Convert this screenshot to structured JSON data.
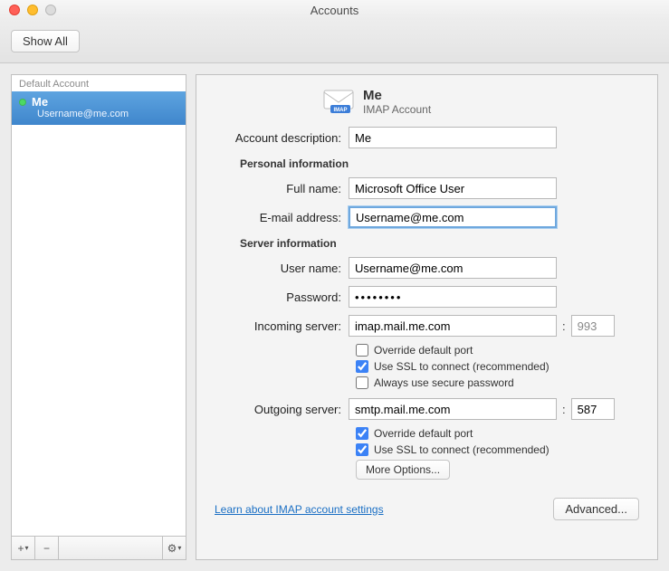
{
  "window": {
    "title": "Accounts"
  },
  "toolbar": {
    "show_all": "Show All"
  },
  "sidebar": {
    "header": "Default Account",
    "account": {
      "name": "Me",
      "email": "Username@me.com"
    },
    "footer": {
      "add": "+",
      "remove": "−",
      "add_caret": "▾",
      "gear": "⚙",
      "gear_caret": "▾"
    }
  },
  "main": {
    "header": {
      "name": "Me",
      "type": "IMAP Account",
      "badge": "IMAP"
    },
    "labels": {
      "account_description": "Account description:",
      "personal_info": "Personal information",
      "full_name": "Full name:",
      "email": "E-mail address:",
      "server_info": "Server information",
      "user_name": "User name:",
      "password": "Password:",
      "incoming": "Incoming server:",
      "outgoing": "Outgoing server:",
      "override_port": "Override default port",
      "use_ssl": "Use SSL to connect (recommended)",
      "secure_pw": "Always use secure password",
      "more_options": "More Options...",
      "learn": "Learn about IMAP account settings",
      "advanced": "Advanced...",
      "port_sep": ":"
    },
    "values": {
      "account_description": "Me",
      "full_name": "Microsoft Office User",
      "email": "Username@me.com",
      "user_name": "Username@me.com",
      "password": "••••••••",
      "incoming_server": "imap.mail.me.com",
      "incoming_port": "993",
      "outgoing_server": "smtp.mail.me.com",
      "outgoing_port": "587"
    },
    "checks": {
      "in_override": false,
      "in_ssl": true,
      "in_secure_pw": false,
      "out_override": true,
      "out_ssl": true
    }
  }
}
